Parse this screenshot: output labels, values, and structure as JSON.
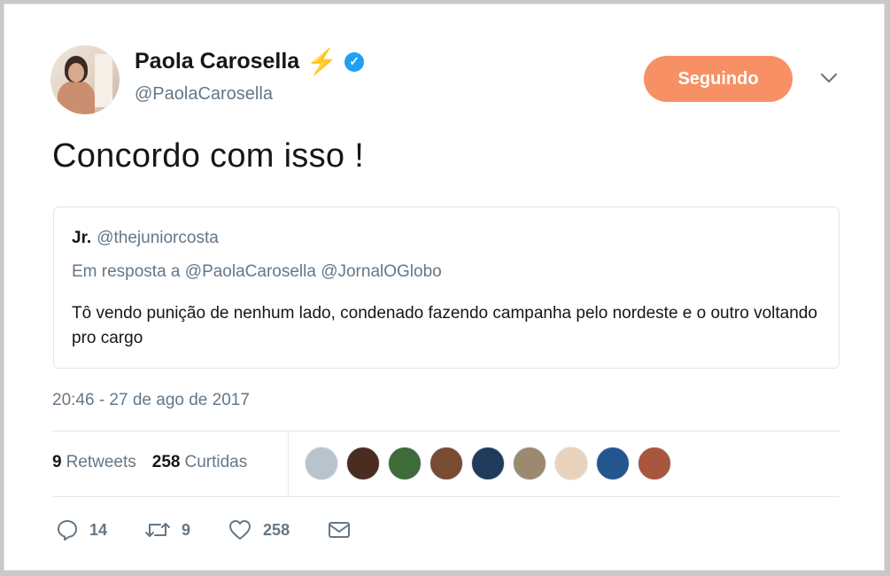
{
  "author": {
    "display_name": "Paola Carosella",
    "handle": "@PaolaCarosella",
    "emoji": "⚡",
    "verified_icon": "✓",
    "follow_button_label": "Seguindo",
    "follow_button_color": "#f79165",
    "verified_color": "#1da1f2"
  },
  "tweet": {
    "text": "Concordo com isso !",
    "timestamp": "20:46 - 27 de ago de 2017"
  },
  "quoted_tweet": {
    "name": "Jr.",
    "handle": "@thejuniorcosta",
    "reply_to": "Em resposta a @PaolaCarosella @JornalOGlobo",
    "text": "Tô vendo punição de nenhum lado, condenado fazendo campanha pelo nordeste e o outro voltando pro cargo"
  },
  "stats": {
    "retweets_count": "9",
    "retweets_label": "Retweets",
    "likes_count": "258",
    "likes_label": "Curtidas"
  },
  "likers": [
    {
      "name": "liker-avatar-1",
      "color": "#b8c4cc"
    },
    {
      "name": "liker-avatar-2",
      "color": "#4a2c20"
    },
    {
      "name": "liker-avatar-3",
      "color": "#3e6b3a"
    },
    {
      "name": "liker-avatar-4",
      "color": "#7a4b33"
    },
    {
      "name": "liker-avatar-5",
      "color": "#1f3b5c"
    },
    {
      "name": "liker-avatar-6",
      "color": "#9b8a70"
    },
    {
      "name": "liker-avatar-7",
      "color": "#e9d3bd"
    },
    {
      "name": "liker-avatar-8",
      "color": "#23568f"
    },
    {
      "name": "liker-avatar-9",
      "color": "#a8563e"
    }
  ],
  "actions": {
    "reply_count": "14",
    "retweet_count": "9",
    "like_count": "258",
    "icons": [
      "reply-icon",
      "retweet-icon",
      "like-icon",
      "direct-message-icon"
    ]
  }
}
